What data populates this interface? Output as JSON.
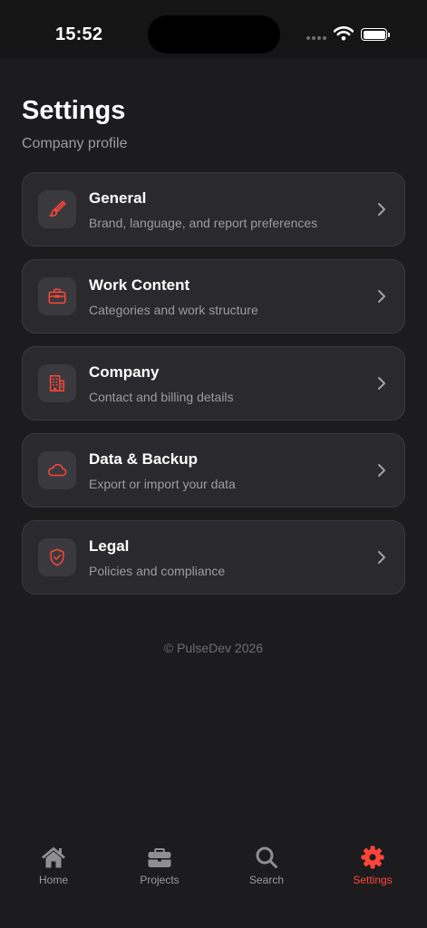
{
  "status_bar": {
    "time": "15:52"
  },
  "header": {
    "title": "Settings",
    "subtitle": "Company profile"
  },
  "cards": [
    {
      "title": "General",
      "description": "Brand, language, and report preferences",
      "icon": "paintbrush-icon"
    },
    {
      "title": "Work Content",
      "description": "Categories and work structure",
      "icon": "briefcase-icon"
    },
    {
      "title": "Company",
      "description": "Contact and billing details",
      "icon": "building-icon"
    },
    {
      "title": "Data & Backup",
      "description": "Export or import your data",
      "icon": "cloud-icon"
    },
    {
      "title": "Legal",
      "description": "Policies and compliance",
      "icon": "shield-check-icon"
    }
  ],
  "footer": {
    "copyright": "© PulseDev 2026"
  },
  "tab_bar": {
    "tabs": [
      {
        "label": "Home",
        "icon": "house-icon",
        "active": false
      },
      {
        "label": "Projects",
        "icon": "briefcase-icon",
        "active": false
      },
      {
        "label": "Search",
        "icon": "search-icon",
        "active": false
      },
      {
        "label": "Settings",
        "icon": "gear-icon",
        "active": true
      }
    ]
  },
  "colors": {
    "accent": "#ff453a",
    "background": "#1c1c1e",
    "card": "#2a2a2e",
    "muted_text": "#9b9ba0"
  }
}
